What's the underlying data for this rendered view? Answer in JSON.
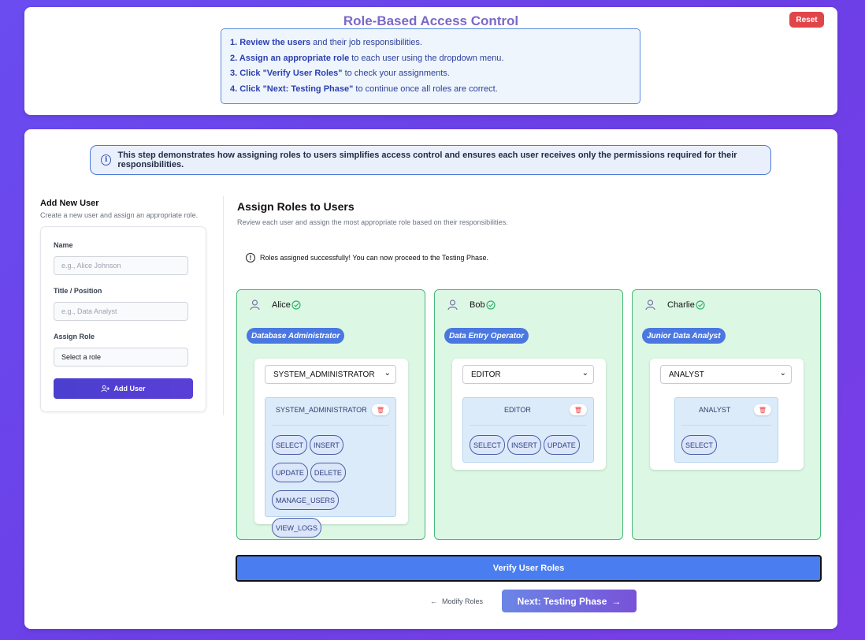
{
  "header": {
    "title": "Role-Based Access Control",
    "reset_label": "Reset",
    "instructions": [
      {
        "bold": "1. Review the users",
        "rest": " and their job responsibilities."
      },
      {
        "bold": "2. Assign an appropriate role",
        "rest": " to each user using the dropdown menu."
      },
      {
        "bold": "3. Click \"Verify User Roles\"",
        "rest": " to check your assignments."
      },
      {
        "bold": "4. Click \"Next: Testing Phase\"",
        "rest": " to continue once all roles are correct."
      }
    ]
  },
  "info_banner": "This step demonstrates how assigning roles to users simplifies access control and ensures each user receives only the permissions required for their responsibilities.",
  "add_user": {
    "title": "Add New User",
    "subtitle": "Create a new user and assign an appropriate role.",
    "name_label": "Name",
    "name_placeholder": "e.g., Alice Johnson",
    "title_label": "Title / Position",
    "title_placeholder": "e.g., Data Analyst",
    "role_label": "Assign Role",
    "role_value": "Select a role",
    "button_label": "Add User"
  },
  "assign": {
    "title": "Assign Roles to Users",
    "subtitle": "Review each user and assign the most appropriate role based on their responsibilities.",
    "success": "Roles assigned successfully! You can now proceed to the Testing Phase."
  },
  "users": [
    {
      "name": "Alice",
      "job": "Database Administrator",
      "selected_role": "SYSTEM_ADMINISTRATOR",
      "role_name": "SYSTEM_ADMINISTRATOR",
      "permissions": [
        "SELECT",
        "INSERT",
        "UPDATE",
        "DELETE",
        "MANAGE_USERS",
        "VIEW_LOGS"
      ]
    },
    {
      "name": "Bob",
      "job": "Data Entry Operator",
      "selected_role": "EDITOR",
      "role_name": "EDITOR",
      "permissions": [
        "SELECT",
        "INSERT",
        "UPDATE"
      ]
    },
    {
      "name": "Charlie",
      "job": "Junior Data Analyst",
      "selected_role": "ANALYST",
      "role_name": "ANALYST",
      "permissions": [
        "SELECT"
      ]
    }
  ],
  "footer": {
    "verify_label": "Verify User Roles",
    "modify_label": "Modify Roles",
    "next_label": "Next: Testing Phase"
  },
  "icons": {
    "user": "user-icon",
    "check": "check-circle-icon",
    "info": "info-icon",
    "trash": "trash-icon",
    "add_user": "user-plus-icon",
    "arrow_left": "arrow-left-icon",
    "arrow_right": "arrow-right-icon",
    "chevron": "chevron-down-icon"
  },
  "colors": {
    "accent": "#4a7ef0",
    "success_bg": "#dcf8e4",
    "success_border": "#48b978",
    "danger": "#e0454a"
  }
}
